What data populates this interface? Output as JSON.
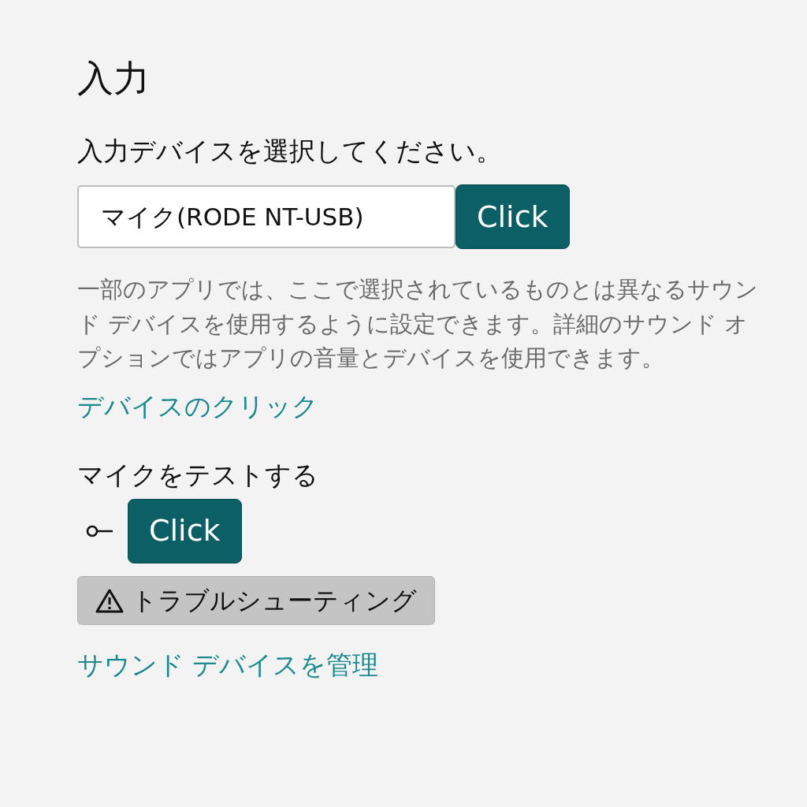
{
  "title": "入力",
  "device_prompt": "入力デバイスを選択してください。",
  "device_select": {
    "value": "マイク(RODE NT-USB)"
  },
  "device_button": "Click",
  "description": "一部のアプリでは、ここで選択されているものとは異なるサウンド デバイスを使用するように設定できます。詳細のサウンド オプションではアプリの音量とデバイスを使用できます。",
  "device_link": "デバイスのクリック",
  "test_heading": "マイクをテストする",
  "test_button": "Click",
  "troubleshoot_button": "トラブルシューティング",
  "manage_link": "サウンド デバイスを管理"
}
